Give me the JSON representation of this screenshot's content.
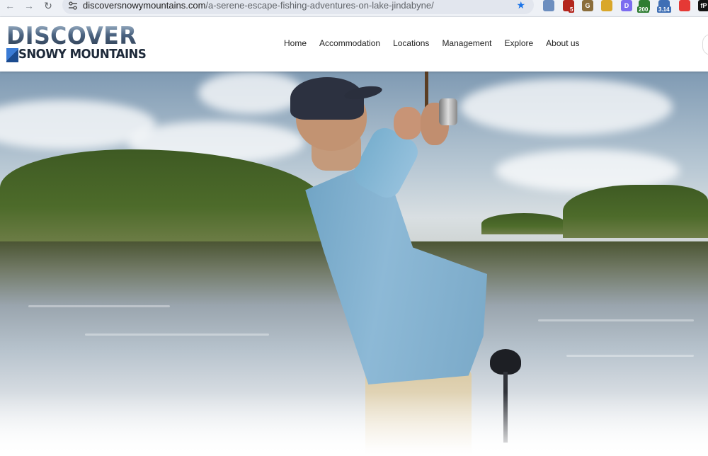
{
  "browser": {
    "url_domain": "discoversnowymountains.com",
    "url_path": "/a-serene-escape-fishing-adventures-on-lake-jindabyne/",
    "extensions": [
      {
        "icon": "antenna-icon",
        "color": "#6c8ebf"
      },
      {
        "icon": "shield-icon",
        "color": "#b3261e",
        "badge": "5"
      },
      {
        "icon": "grammar-icon",
        "color": "#8a6d3b",
        "label": "G"
      },
      {
        "icon": "sun-icon",
        "color": "#d9a72a"
      },
      {
        "icon": "d-icon",
        "color": "#7c6cf0",
        "label": "D"
      },
      {
        "icon": "counter-icon",
        "color": "#2e7d32",
        "badge": "200"
      },
      {
        "icon": "version-icon",
        "color": "#3f6fb5",
        "badge": "3.14"
      },
      {
        "icon": "color-icon",
        "color": "#e53935"
      },
      {
        "icon": "fp-icon",
        "color": "#111111",
        "label": "fP"
      }
    ]
  },
  "site": {
    "logo_top": "DISCOVER",
    "logo_bottom": "SNOWY MOUNTAINS",
    "nav": [
      "Home",
      "Accommodation",
      "Locations",
      "Management",
      "Explore",
      "About us"
    ]
  },
  "colors": {
    "accent": "#1a73e8",
    "header_bg": "#ffffff",
    "nav_text": "#222222"
  }
}
